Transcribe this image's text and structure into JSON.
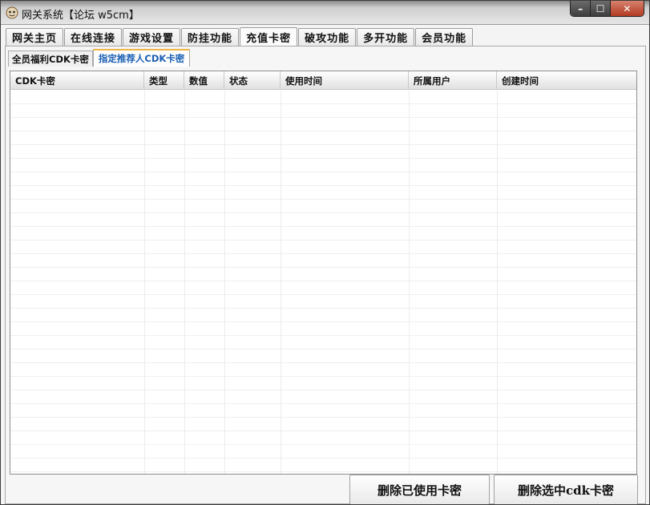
{
  "window": {
    "title": "网关系统【论坛 w5cm】",
    "controls": {
      "minimize": "–",
      "maximize": "☐",
      "close": "✕"
    }
  },
  "top_tabs": [
    {
      "label": "网关主页"
    },
    {
      "label": "在线连接"
    },
    {
      "label": "游戏设置"
    },
    {
      "label": "防挂功能"
    },
    {
      "label": "充值卡密",
      "active": true
    },
    {
      "label": "破攻功能"
    },
    {
      "label": "多开功能"
    },
    {
      "label": "会员功能"
    }
  ],
  "sub_tabs": [
    {
      "label": "全员福利CDK卡密"
    },
    {
      "label": "指定推荐人CDK卡密",
      "active": true
    }
  ],
  "table": {
    "columns": [
      "CDK卡密",
      "类型",
      "数值",
      "状态",
      "使用时间",
      "所属用户",
      "创建时间"
    ],
    "rows": []
  },
  "buttons": {
    "delete_used": "删除已使用卡密",
    "delete_selected": "删除选中cdk卡密"
  },
  "colors": {
    "active_subtab_text": "#1a5fb4",
    "active_subtab_accent": "#f0b447",
    "close_button": "#c34a30"
  }
}
